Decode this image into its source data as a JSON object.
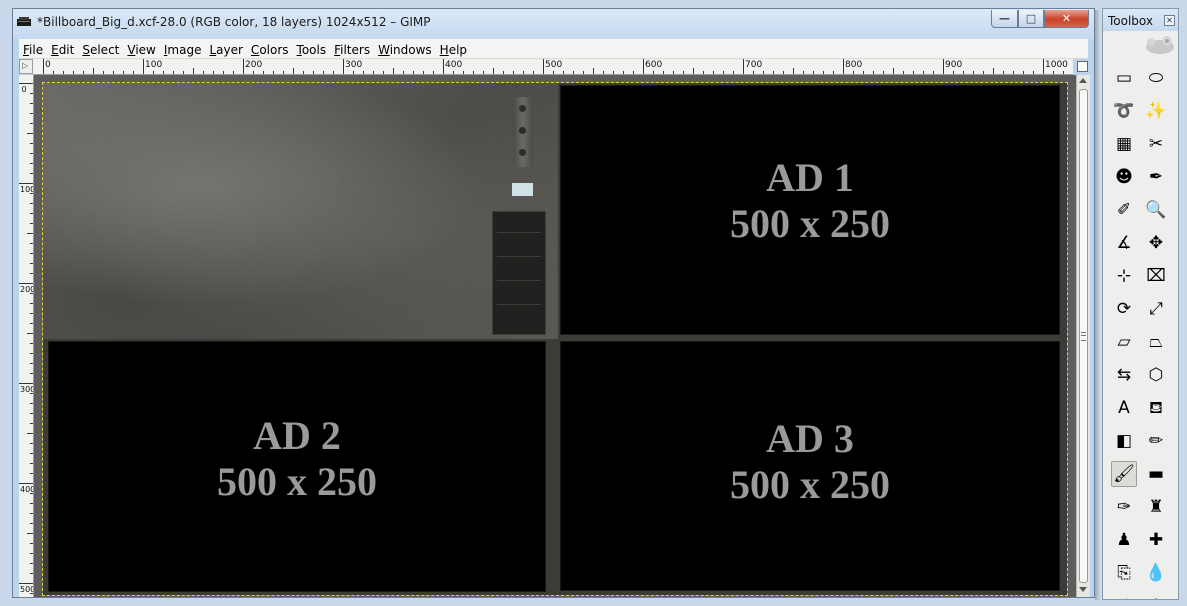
{
  "window": {
    "title": "*Billboard_Big_d.xcf-28.0 (RGB color, 18 layers) 1024x512 – GIMP",
    "minimize": "—",
    "maximize": "□",
    "close": "✕"
  },
  "menubar": {
    "items": [
      {
        "label": "File",
        "name": "menu-file"
      },
      {
        "label": "Edit",
        "name": "menu-edit"
      },
      {
        "label": "Select",
        "name": "menu-select"
      },
      {
        "label": "View",
        "name": "menu-view"
      },
      {
        "label": "Image",
        "name": "menu-image"
      },
      {
        "label": "Layer",
        "name": "menu-layer"
      },
      {
        "label": "Colors",
        "name": "menu-colors"
      },
      {
        "label": "Tools",
        "name": "menu-tools"
      },
      {
        "label": "Filters",
        "name": "menu-filters"
      },
      {
        "label": "Windows",
        "name": "menu-windows"
      },
      {
        "label": "Help",
        "name": "menu-help"
      }
    ]
  },
  "rulers": {
    "horizontal_labels": [
      "0",
      "100",
      "200",
      "300",
      "400",
      "500",
      "600",
      "700",
      "800",
      "900",
      "1000"
    ],
    "vertical_labels": [
      "0",
      "100",
      "200",
      "300",
      "400",
      "500"
    ]
  },
  "canvas": {
    "ad1": {
      "title": "AD 1",
      "size": "500 x 250"
    },
    "ad2": {
      "title": "AD 2",
      "size": "500 x 250"
    },
    "ad3": {
      "title": "AD 3",
      "size": "500 x 250"
    }
  },
  "toolbox": {
    "title": "Toolbox",
    "close": "✕",
    "tools": [
      {
        "name": "rect-select-icon",
        "glyph": "▭"
      },
      {
        "name": "ellipse-select-icon",
        "glyph": "⬭"
      },
      {
        "name": "lasso-select-icon",
        "glyph": "➰"
      },
      {
        "name": "fuzzy-select-icon",
        "glyph": "✨"
      },
      {
        "name": "select-by-color-icon",
        "glyph": "▦"
      },
      {
        "name": "scissors-select-icon",
        "glyph": "✂"
      },
      {
        "name": "foreground-select-icon",
        "glyph": "☻"
      },
      {
        "name": "paths-icon",
        "glyph": "✒"
      },
      {
        "name": "color-picker-icon",
        "glyph": "✐"
      },
      {
        "name": "zoom-icon",
        "glyph": "🔍"
      },
      {
        "name": "measure-icon",
        "glyph": "∡"
      },
      {
        "name": "move-icon",
        "glyph": "✥"
      },
      {
        "name": "align-icon",
        "glyph": "⊹"
      },
      {
        "name": "crop-icon",
        "glyph": "⌧"
      },
      {
        "name": "rotate-icon",
        "glyph": "⟳"
      },
      {
        "name": "scale-icon",
        "glyph": "⤢"
      },
      {
        "name": "shear-icon",
        "glyph": "▱"
      },
      {
        "name": "perspective-icon",
        "glyph": "⏢"
      },
      {
        "name": "flip-icon",
        "glyph": "⇆"
      },
      {
        "name": "cage-transform-icon",
        "glyph": "⬡"
      },
      {
        "name": "text-icon",
        "glyph": "A"
      },
      {
        "name": "bucket-fill-icon",
        "glyph": "⛾"
      },
      {
        "name": "blend-icon",
        "glyph": "◧"
      },
      {
        "name": "pencil-icon",
        "glyph": "✏"
      },
      {
        "name": "paintbrush-icon",
        "glyph": "🖌"
      },
      {
        "name": "eraser-icon",
        "glyph": "▬"
      },
      {
        "name": "airbrush-icon",
        "glyph": "✑"
      },
      {
        "name": "ink-icon",
        "glyph": "♜"
      },
      {
        "name": "clone-icon",
        "glyph": "♟"
      },
      {
        "name": "heal-icon",
        "glyph": "✚"
      },
      {
        "name": "perspective-clone-icon",
        "glyph": "⎘"
      },
      {
        "name": "blur-sharpen-icon",
        "glyph": "💧"
      },
      {
        "name": "smudge-icon",
        "glyph": "☝"
      },
      {
        "name": "dodge-burn-icon",
        "glyph": "⚲"
      }
    ],
    "active_tool": "paintbrush-icon"
  },
  "colors": {
    "titlebar": "#c4d8ef",
    "close_button": "#c7412a",
    "canvas_border": "#e0d23a",
    "ad_text": "#9a9a9a",
    "ad_background": "#000000"
  }
}
